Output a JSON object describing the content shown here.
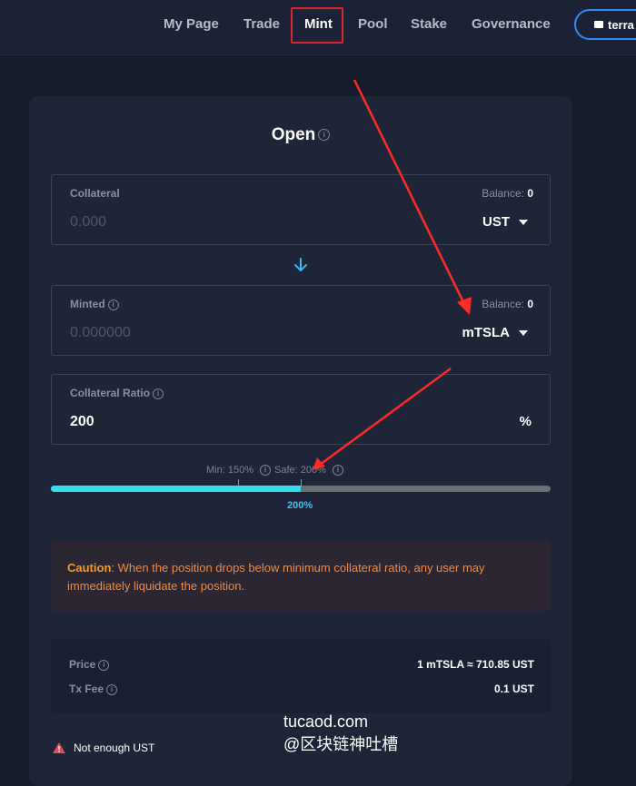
{
  "nav": {
    "items": [
      "My Page",
      "Trade",
      "Mint",
      "Pool",
      "Stake",
      "Governance"
    ],
    "wallet_label": "terra"
  },
  "form": {
    "title": "Open",
    "collateral": {
      "label": "Collateral",
      "balance_label": "Balance:",
      "balance_value": "0",
      "placeholder": "0.000",
      "asset": "UST"
    },
    "minted": {
      "label": "Minted",
      "balance_label": "Balance:",
      "balance_value": "0",
      "placeholder": "0.000000",
      "asset": "mTSLA"
    },
    "ratio": {
      "label": "Collateral Ratio",
      "value": "200",
      "unit": "%"
    },
    "slider": {
      "min_label": "Min: 150%",
      "safe_label": "Safe: 200%",
      "current_label": "200%",
      "fill_fraction": 0.5
    },
    "caution": {
      "title": "Caution",
      "text": ": When the position drops below minimum collateral ratio, any user may immediately liquidate the position."
    },
    "info": {
      "price_label": "Price",
      "price_value": "1 mTSLA ≈ 710.85 UST",
      "fee_label": "Tx Fee",
      "fee_value": "0.1 UST"
    },
    "warning": "Not enough UST"
  },
  "watermark": {
    "line1": "tucaod.com",
    "line2": "@区块链神吐槽"
  },
  "colors": {
    "accent": "#2ee0f0",
    "highlight": "#e0232b",
    "caution": "#f08b41"
  }
}
